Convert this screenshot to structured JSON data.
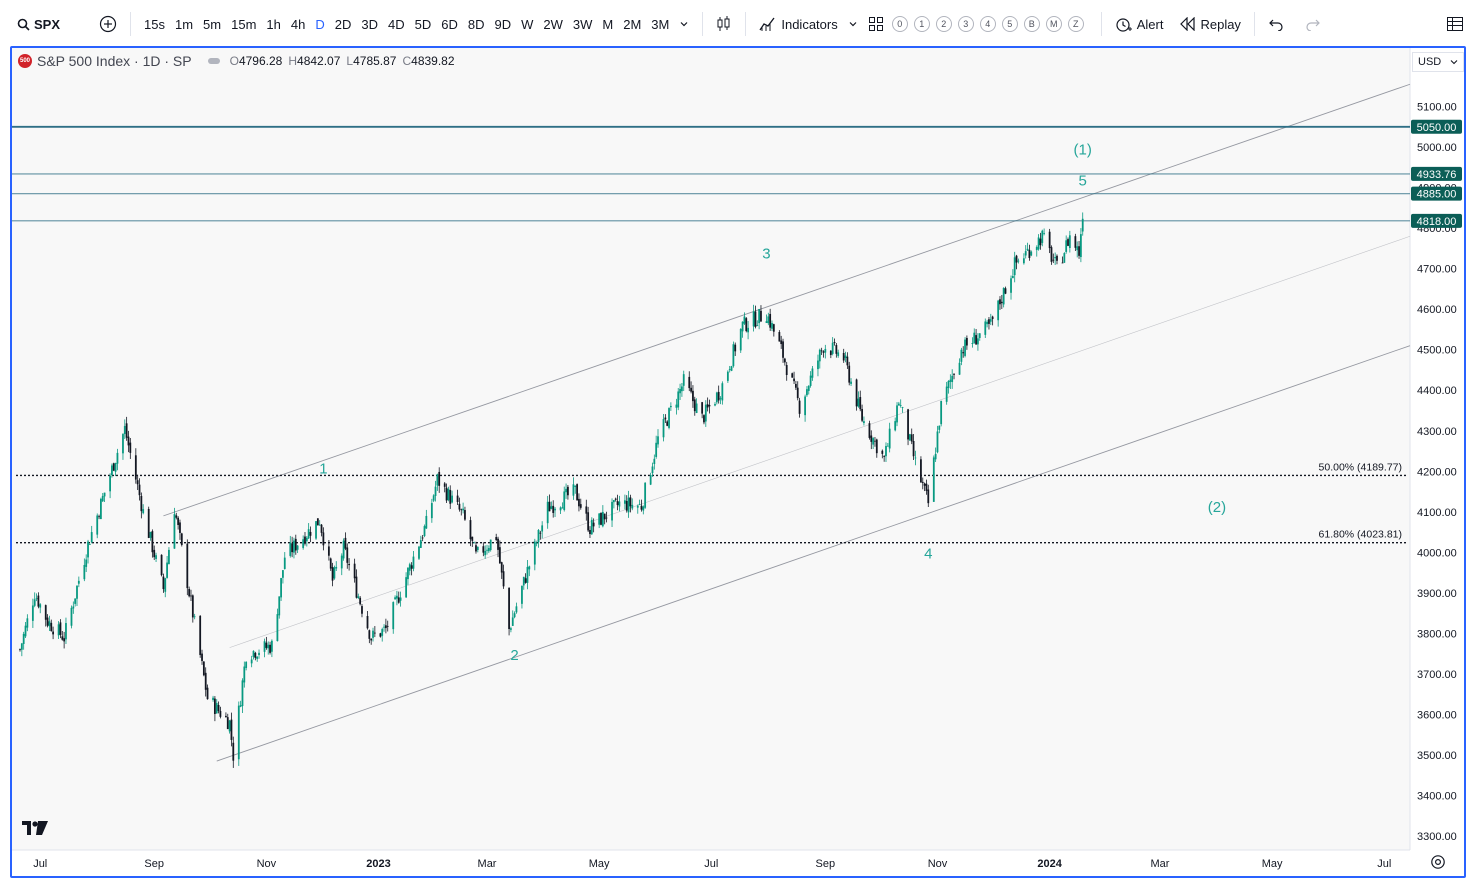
{
  "toolbar": {
    "symbol": "SPX",
    "intervals": [
      "15s",
      "1m",
      "5m",
      "15m",
      "1h",
      "4h",
      "D",
      "2D",
      "3D",
      "4D",
      "5D",
      "6D",
      "8D",
      "9D",
      "W",
      "2W",
      "3W",
      "M",
      "2M",
      "3M"
    ],
    "active_interval": "D",
    "indicators_label": "Indicators",
    "layout_slots": [
      "0",
      "1",
      "2",
      "3",
      "4",
      "5",
      "B",
      "M",
      "Z"
    ],
    "alert_label": "Alert",
    "replay_label": "Replay"
  },
  "legend": {
    "logo_text": "500",
    "name": "S&P 500 Index · 1D · SP",
    "open_label": "O",
    "open": "4796.28",
    "high_label": "H",
    "high": "4842.07",
    "low_label": "L",
    "low": "4785.87",
    "close_label": "C",
    "close": "4839.82"
  },
  "currency": "USD",
  "colors": {
    "up_candle": "#089981",
    "down_candle": "#131722",
    "wave_label": "#26a69a",
    "price_badge": "#0b5e57",
    "horizontal_line": "#2f6f86",
    "channel_line": "#9598a1",
    "selection_border": "#2962ff"
  },
  "chart_data": {
    "type": "candlestick",
    "title": "",
    "y_axis": {
      "min": 3300,
      "max": 5100,
      "ticks": [
        "5100.00",
        "5000.00",
        "4900.00",
        "4800.00",
        "4700.00",
        "4600.00",
        "4500.00",
        "4400.00",
        "4300.00",
        "4200.00",
        "4100.00",
        "4000.00",
        "3900.00",
        "3800.00",
        "3700.00",
        "3600.00",
        "3500.00",
        "3400.00",
        "3300.00"
      ]
    },
    "x_axis": {
      "start": "2022-06-20",
      "end": "2024-07-15",
      "ticks": [
        {
          "label": "Jul",
          "date": "2022-07-01",
          "bold": false
        },
        {
          "label": "Sep",
          "date": "2022-09-01",
          "bold": false
        },
        {
          "label": "Nov",
          "date": "2022-11-01",
          "bold": false
        },
        {
          "label": "2023",
          "date": "2023-01-01",
          "bold": true
        },
        {
          "label": "Mar",
          "date": "2023-03-01",
          "bold": false
        },
        {
          "label": "May",
          "date": "2023-05-01",
          "bold": false
        },
        {
          "label": "Jul",
          "date": "2023-07-01",
          "bold": false
        },
        {
          "label": "Sep",
          "date": "2023-09-01",
          "bold": false
        },
        {
          "label": "Nov",
          "date": "2023-11-01",
          "bold": false
        },
        {
          "label": "2024",
          "date": "2024-01-01",
          "bold": true
        },
        {
          "label": "Mar",
          "date": "2024-03-01",
          "bold": false
        },
        {
          "label": "May",
          "date": "2024-05-01",
          "bold": false
        },
        {
          "label": "Jul",
          "date": "2024-07-01",
          "bold": false
        }
      ]
    },
    "price_path": [
      {
        "date": "2022-06-20",
        "close": 3760
      },
      {
        "date": "2022-06-28",
        "close": 3900
      },
      {
        "date": "2022-07-05",
        "close": 3830
      },
      {
        "date": "2022-07-14",
        "close": 3790
      },
      {
        "date": "2022-07-27",
        "close": 4020
      },
      {
        "date": "2022-08-16",
        "close": 4305
      },
      {
        "date": "2022-08-26",
        "close": 4100
      },
      {
        "date": "2022-09-06",
        "close": 3910
      },
      {
        "date": "2022-09-12",
        "close": 4110
      },
      {
        "date": "2022-09-30",
        "close": 3640
      },
      {
        "date": "2022-10-12",
        "close": 3580
      },
      {
        "date": "2022-10-14",
        "close": 3500
      },
      {
        "date": "2022-10-21",
        "close": 3750
      },
      {
        "date": "2022-11-04",
        "close": 3770
      },
      {
        "date": "2022-11-11",
        "close": 3990
      },
      {
        "date": "2022-11-30",
        "close": 4080
      },
      {
        "date": "2022-12-07",
        "close": 3930
      },
      {
        "date": "2022-12-13",
        "close": 4010
      },
      {
        "date": "2022-12-28",
        "close": 3790
      },
      {
        "date": "2023-01-05",
        "close": 3810
      },
      {
        "date": "2023-01-27",
        "close": 4070
      },
      {
        "date": "2023-02-02",
        "close": 4180
      },
      {
        "date": "2023-02-16",
        "close": 4090
      },
      {
        "date": "2023-02-23",
        "close": 3990
      },
      {
        "date": "2023-03-06",
        "close": 4040
      },
      {
        "date": "2023-03-13",
        "close": 3810
      },
      {
        "date": "2023-03-22",
        "close": 3940
      },
      {
        "date": "2023-04-03",
        "close": 4110
      },
      {
        "date": "2023-04-18",
        "close": 4150
      },
      {
        "date": "2023-04-26",
        "close": 4060
      },
      {
        "date": "2023-05-12",
        "close": 4120
      },
      {
        "date": "2023-05-24",
        "close": 4115
      },
      {
        "date": "2023-06-02",
        "close": 4280
      },
      {
        "date": "2023-06-16",
        "close": 4420
      },
      {
        "date": "2023-06-26",
        "close": 4330
      },
      {
        "date": "2023-07-06",
        "close": 4400
      },
      {
        "date": "2023-07-18",
        "close": 4560
      },
      {
        "date": "2023-07-31",
        "close": 4590
      },
      {
        "date": "2023-08-08",
        "close": 4500
      },
      {
        "date": "2023-08-18",
        "close": 4360
      },
      {
        "date": "2023-08-31",
        "close": 4510
      },
      {
        "date": "2023-09-05",
        "close": 4500
      },
      {
        "date": "2023-09-11",
        "close": 4480
      },
      {
        "date": "2023-09-21",
        "close": 4330
      },
      {
        "date": "2023-10-03",
        "close": 4230
      },
      {
        "date": "2023-10-11",
        "close": 4375
      },
      {
        "date": "2023-10-20",
        "close": 4220
      },
      {
        "date": "2023-10-27",
        "close": 4120
      },
      {
        "date": "2023-11-03",
        "close": 4360
      },
      {
        "date": "2023-11-14",
        "close": 4500
      },
      {
        "date": "2023-11-30",
        "close": 4560
      },
      {
        "date": "2023-12-13",
        "close": 4710
      },
      {
        "date": "2023-12-28",
        "close": 4780
      },
      {
        "date": "2024-01-05",
        "close": 4700
      },
      {
        "date": "2024-01-12",
        "close": 4780
      },
      {
        "date": "2024-01-17",
        "close": 4740
      },
      {
        "date": "2024-01-19",
        "close": 4840
      }
    ],
    "horizontal_levels": [
      {
        "value": 5050.0,
        "label": "5050.00"
      },
      {
        "value": 4933.76,
        "label": "4933.76"
      },
      {
        "value": 4885.0,
        "label": "4885.00"
      },
      {
        "value": 4818.0,
        "label": "4818.00"
      }
    ],
    "fib_levels": [
      {
        "value": 4189.77,
        "label": "50.00% (4189.77)"
      },
      {
        "value": 4023.81,
        "label": "61.80% (4023.81)"
      }
    ],
    "channel_lines": [
      {
        "name": "upper",
        "points": [
          {
            "date": "2022-09-06",
            "value": 4090
          },
          {
            "date": "2024-07-15",
            "value": 5155
          }
        ]
      },
      {
        "name": "middle",
        "points": [
          {
            "date": "2022-10-12",
            "value": 3765
          },
          {
            "date": "2024-07-15",
            "value": 4780
          }
        ]
      },
      {
        "name": "lower",
        "points": [
          {
            "date": "2022-10-05",
            "value": 3485
          },
          {
            "date": "2024-07-15",
            "value": 4510
          }
        ]
      }
    ],
    "wave_labels": [
      {
        "text": "1",
        "date": "2022-12-02",
        "value": 4195
      },
      {
        "text": "2",
        "date": "2023-03-16",
        "value": 3735
      },
      {
        "text": "3",
        "date": "2023-07-31",
        "value": 4725
      },
      {
        "text": "4",
        "date": "2023-10-27",
        "value": 3985
      },
      {
        "text": "5",
        "date": "2024-01-19",
        "value": 4905
      },
      {
        "text": "(1)",
        "date": "2024-01-19",
        "value": 4982
      },
      {
        "text": "(2)",
        "date": "2024-04-01",
        "value": 4100
      }
    ]
  }
}
